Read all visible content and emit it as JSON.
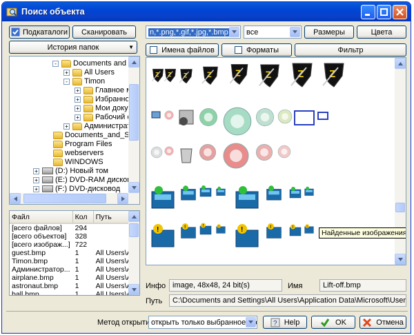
{
  "window": {
    "title": "Поиск объекта"
  },
  "toolbar": {
    "subdirs_label": "Подкаталоги",
    "scan_label": "Сканировать",
    "mask_value": "n,*.png,*.gif,*.jpg,*.bmp",
    "all_value": "все",
    "sizes_label": "Размеры",
    "colors_label": "Цвета",
    "history_label": "История папок",
    "filenames_label": "Имена файлов",
    "formats_label": "Форматы",
    "filter_label": "Фильтр"
  },
  "tree": {
    "items": [
      {
        "label": "Documents and Setti",
        "icon": "folder-open"
      },
      {
        "label": "All Users",
        "icon": "folder"
      },
      {
        "label": "Timon",
        "icon": "folder-open"
      },
      {
        "label": "Главное мен",
        "icon": "folder"
      },
      {
        "label": "Избранное",
        "icon": "folder"
      },
      {
        "label": "Мои докуме",
        "icon": "folder"
      },
      {
        "label": "Рабочий стс",
        "icon": "folder"
      },
      {
        "label": "Администратор",
        "icon": "folder"
      },
      {
        "label": "Documents_and_Set",
        "icon": "folder"
      },
      {
        "label": "Program Files",
        "icon": "folder"
      },
      {
        "label": "webservers",
        "icon": "folder"
      },
      {
        "label": "WINDOWS",
        "icon": "folder"
      },
      {
        "label": "(D:) Новый том",
        "icon": "drive"
      },
      {
        "label": "(E:) DVD-RAM дисковод",
        "icon": "drive"
      },
      {
        "label": "(F:) DVD-дисковод",
        "icon": "drive"
      }
    ]
  },
  "list": {
    "headers": {
      "file": "Файл",
      "count": "Кол",
      "path": "Путь"
    },
    "rows": [
      {
        "file": "[всего файлов]",
        "count": "294",
        "path": ""
      },
      {
        "file": "[всего объектов]",
        "count": "328",
        "path": ""
      },
      {
        "file": "[всего изображ...]",
        "count": "722",
        "path": ""
      },
      {
        "file": "guest.bmp",
        "count": "1",
        "path": "All Users\\Ap"
      },
      {
        "file": "Timon.bmp",
        "count": "1",
        "path": "All Users\\Ap"
      },
      {
        "file": "Администратор...",
        "count": "1",
        "path": "All Users\\Ap"
      },
      {
        "file": "airplane.bmp",
        "count": "1",
        "path": "All Users\\Ap"
      },
      {
        "file": "astronaut.bmp",
        "count": "1",
        "path": "All Users\\Ap"
      },
      {
        "file": "ball.bmp",
        "count": "1",
        "path": "All Users\\Ap"
      }
    ]
  },
  "tooltip": {
    "text": "Найденные изображения"
  },
  "info": {
    "info_label": "Инфо",
    "info_value": "image, 48x48, 24 bit(s)",
    "name_label": "Имя",
    "name_value": "Lift-off.bmp",
    "path_label": "Путь",
    "path_value": "C:\\Documents and Settings\\All Users\\Application Data\\Microsoft\\User Account Pic"
  },
  "footer": {
    "method_label": "Метод открытия",
    "method_value": "открыть только выбранное изо",
    "help_label": "Help",
    "ok_label": "OK",
    "cancel_label": "Отмена"
  },
  "colors": {
    "title_bar": "#0046d5",
    "window_bg": "#ece9d8",
    "selection": "#316ac5"
  }
}
